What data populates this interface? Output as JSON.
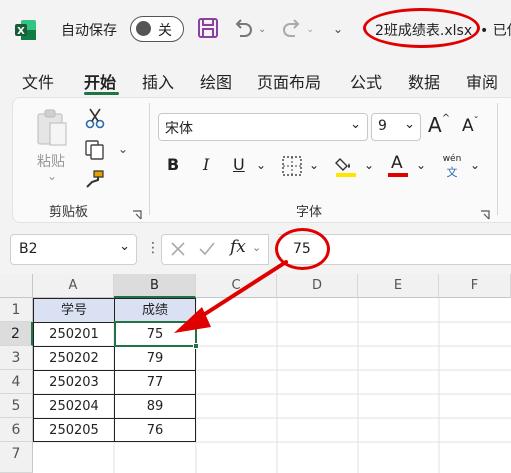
{
  "titlebar": {
    "autosave_label": "自动保存",
    "autosave_toggle": "关",
    "filename": "2班成绩表.xlsx",
    "status_text": "• 已保"
  },
  "menu": {
    "tabs": [
      "文件",
      "开始",
      "插入",
      "绘图",
      "页面布局",
      "公式",
      "数据",
      "审阅"
    ],
    "active": "开始"
  },
  "ribbon": {
    "clipboard": {
      "paste_label": "粘贴",
      "group_label": "剪贴板"
    },
    "font": {
      "font_name": "宋体",
      "font_size": "9",
      "bold": "B",
      "italic": "I",
      "underline": "U",
      "font_color_glyph": "A",
      "phonetic_top": "wén",
      "phonetic_bottom": "文",
      "group_label": "字体",
      "grow_glyph": "A",
      "shrink_glyph": "A"
    }
  },
  "formula_bar": {
    "name_box": "B2",
    "fx": "fx",
    "value": "75"
  },
  "sheet": {
    "column_headers": [
      "A",
      "B",
      "C",
      "D",
      "E",
      "F"
    ],
    "row_headers": [
      "1",
      "2",
      "3",
      "4",
      "5",
      "6",
      "7"
    ],
    "table_header": [
      "学号",
      "成绩"
    ],
    "rows": [
      [
        "250201",
        "75"
      ],
      [
        "250202",
        "79"
      ],
      [
        "250203",
        "77"
      ],
      [
        "250204",
        "89"
      ],
      [
        "250205",
        "76"
      ]
    ],
    "selected_cell": "B2"
  },
  "colors": {
    "excel_green": "#217346",
    "annotation_red": "#e00000",
    "header_fill": "#d9e1f2",
    "save_purple": "#8b3fa0"
  }
}
